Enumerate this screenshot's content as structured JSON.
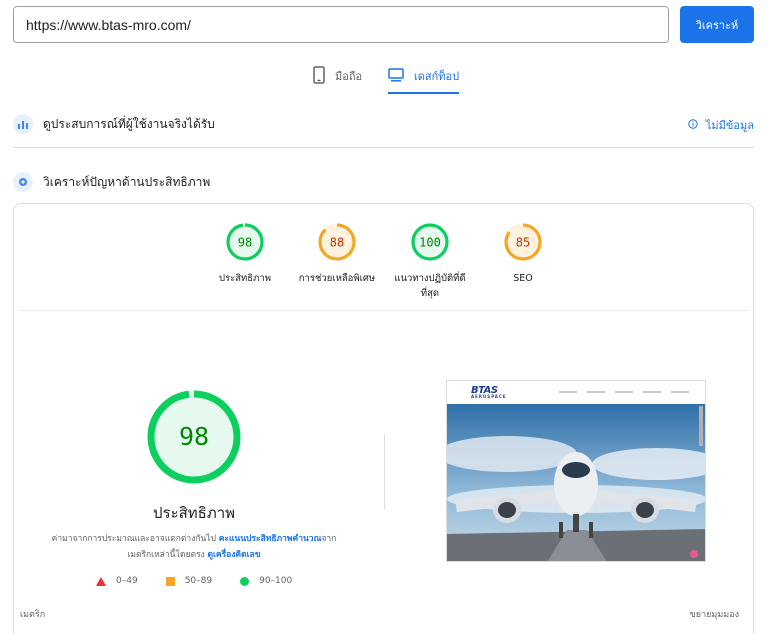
{
  "search": {
    "url": "https://www.btas-mro.com/",
    "analyze_label": "วิเคราะห์"
  },
  "device_tabs": [
    {
      "label": "มือถือ",
      "icon": "mobile-phone-icon",
      "active": false
    },
    {
      "label": "เดสก์ท็อป",
      "icon": "desktop-monitor-icon",
      "active": true
    }
  ],
  "crux": {
    "title": "ดูประสบการณ์ที่ผู้ใช้งานจริงได้รับ",
    "no_data": "ไม่มีข้อมูล"
  },
  "diagnose": {
    "title": "วิเคราะห์ปัญหาด้านประสิทธิภาพ"
  },
  "scores": [
    {
      "value": 98,
      "label": "ประสิทธิภาพ",
      "color": "#0ccf5d",
      "fraction": 0.98
    },
    {
      "value": 88,
      "label": "การช่วยเหลือพิเศษ",
      "color": "#f5a623",
      "fraction": 0.88
    },
    {
      "value": 100,
      "label": "แนวทางปฏิบัติที่ดีที่สุด",
      "color": "#0ccf5d",
      "fraction": 1.0
    },
    {
      "value": 85,
      "label": "SEO",
      "color": "#f5a623",
      "fraction": 0.85
    }
  ],
  "performance": {
    "score": 98,
    "fraction": 0.98,
    "title": "ประสิทธิภาพ",
    "note_prefix": "ค่ามาจากการประมาณและอาจแตกต่างกันไป",
    "note_link1": "คะแนนประสิทธิภาพคำนวณ",
    "note_middle": "จากเมตริกเหล่านี้โดยตรง",
    "note_link2": "ดูเครื่องคิดเลข"
  },
  "legend": [
    {
      "range": "0–49",
      "shape": "triangle",
      "color": "#eb3333"
    },
    {
      "range": "50–89",
      "shape": "square",
      "color": "#f5a623"
    },
    {
      "range": "90–100",
      "shape": "circle",
      "color": "#0ccf5d"
    }
  ],
  "screenshot": {
    "logo": "BTAS",
    "logo_sub": "AEROSPACE"
  },
  "footer": {
    "metrics_label": "เมตริก",
    "expand_label": "ขยายมุมมอง"
  },
  "colors": {
    "accent": "#1a73e8",
    "pass": "#0ccf5d",
    "average": "#f5a623",
    "fail": "#eb3333"
  }
}
